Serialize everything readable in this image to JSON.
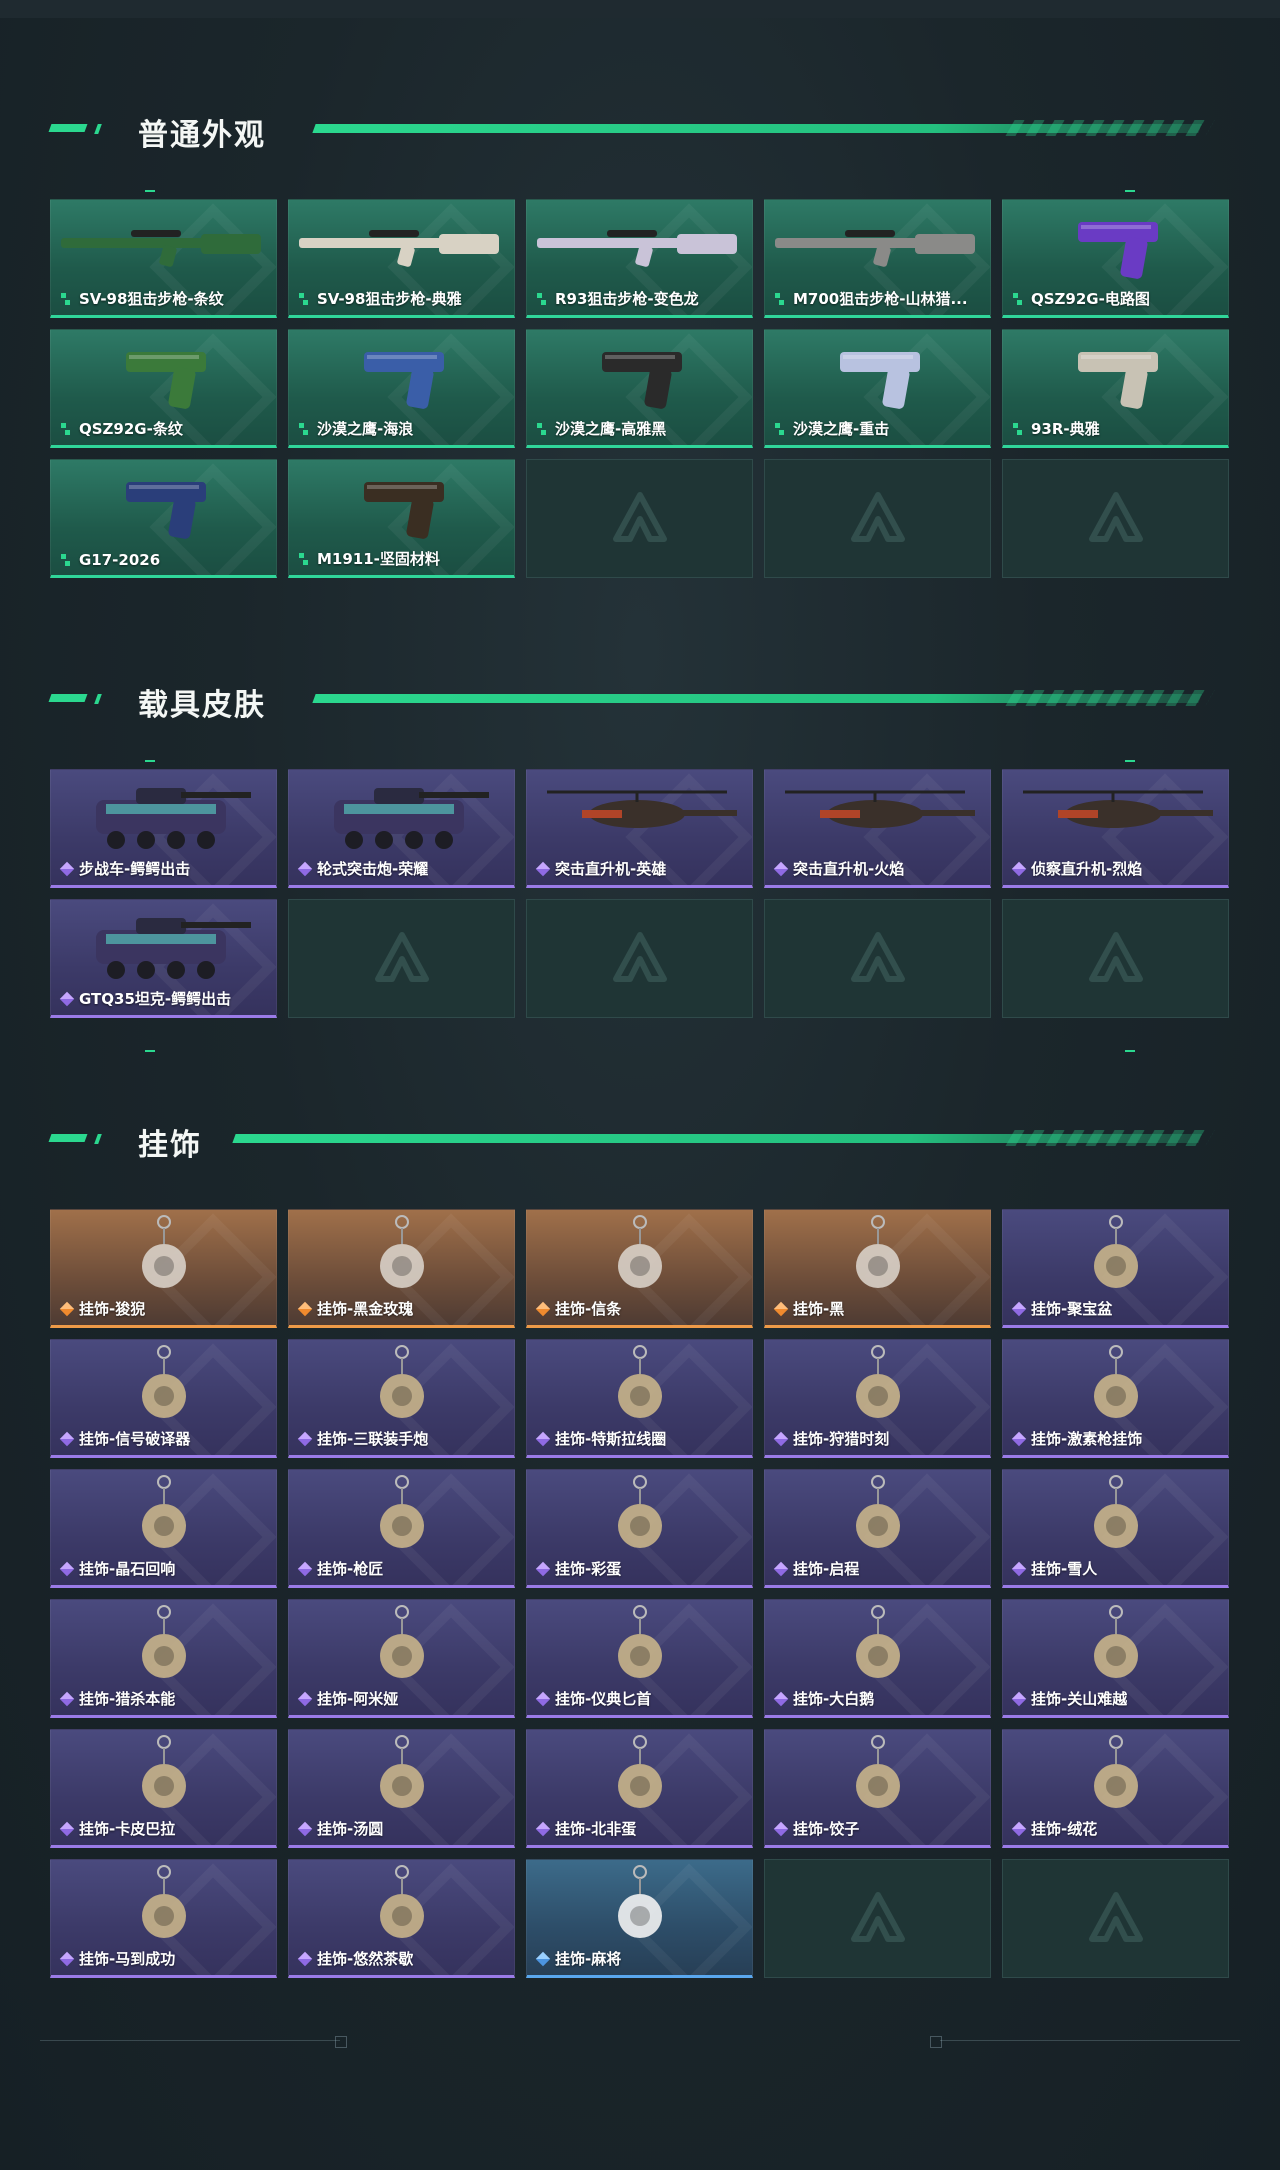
{
  "sections": [
    {
      "title": "普通外观",
      "items": [
        {
          "name": "SV-98狙击步枪-条纹",
          "rarity": "green",
          "icon": "sniper-rifle-icon"
        },
        {
          "name": "SV-98狙击步枪-典雅",
          "rarity": "green",
          "icon": "sniper-rifle-icon"
        },
        {
          "name": "R93狙击步枪-变色龙",
          "rarity": "green",
          "icon": "sniper-rifle-icon"
        },
        {
          "name": "M700狙击步枪-山林猎...",
          "rarity": "green",
          "icon": "sniper-rifle-icon"
        },
        {
          "name": "QSZ92G-电路图",
          "rarity": "green",
          "icon": "pistol-icon"
        },
        {
          "name": "QSZ92G-条纹",
          "rarity": "green",
          "icon": "pistol-icon"
        },
        {
          "name": "沙漠之鹰-海浪",
          "rarity": "green",
          "icon": "pistol-icon"
        },
        {
          "name": "沙漠之鹰-高雅黑",
          "rarity": "green",
          "icon": "pistol-icon"
        },
        {
          "name": "沙漠之鹰-重击",
          "rarity": "green",
          "icon": "pistol-icon"
        },
        {
          "name": "93R-典雅",
          "rarity": "green",
          "icon": "pistol-icon"
        },
        {
          "name": "G17-2026",
          "rarity": "green",
          "icon": "pistol-icon"
        },
        {
          "name": "M1911-坚固材料",
          "rarity": "green",
          "icon": "pistol-icon"
        }
      ],
      "empty_slots": 3
    },
    {
      "title": "载具皮肤",
      "items": [
        {
          "name": "步战车-鳄鳄出击",
          "rarity": "purple",
          "icon": "armored-vehicle-icon"
        },
        {
          "name": "轮式突击炮-荣耀",
          "rarity": "purple",
          "icon": "armored-vehicle-icon"
        },
        {
          "name": "突击直升机-英雄",
          "rarity": "purple",
          "icon": "helicopter-icon"
        },
        {
          "name": "突击直升机-火焰",
          "rarity": "purple",
          "icon": "helicopter-icon"
        },
        {
          "name": "侦察直升机-烈焰",
          "rarity": "purple",
          "icon": "helicopter-icon"
        },
        {
          "name": "GTQ35坦克-鳄鳄出击",
          "rarity": "purple",
          "icon": "tank-icon"
        }
      ],
      "empty_slots": 4
    },
    {
      "title": "挂饰",
      "items": [
        {
          "name": "挂饰-狻猊",
          "rarity": "orange",
          "icon": "charm-icon"
        },
        {
          "name": "挂饰-黑金玫瑰",
          "rarity": "orange",
          "icon": "charm-icon"
        },
        {
          "name": "挂饰-信条",
          "rarity": "orange",
          "icon": "charm-icon"
        },
        {
          "name": "挂饰-黑",
          "rarity": "orange",
          "icon": "charm-icon"
        },
        {
          "name": "挂饰-聚宝盆",
          "rarity": "purple",
          "icon": "charm-icon"
        },
        {
          "name": "挂饰-信号破译器",
          "rarity": "purple",
          "icon": "charm-icon"
        },
        {
          "name": "挂饰-三联装手炮",
          "rarity": "purple",
          "icon": "charm-icon"
        },
        {
          "name": "挂饰-特斯拉线圈",
          "rarity": "purple",
          "icon": "charm-icon"
        },
        {
          "name": "挂饰-狩猎时刻",
          "rarity": "purple",
          "icon": "charm-icon"
        },
        {
          "name": "挂饰-激素枪挂饰",
          "rarity": "purple",
          "icon": "charm-icon"
        },
        {
          "name": "挂饰-晶石回响",
          "rarity": "purple",
          "icon": "charm-icon"
        },
        {
          "name": "挂饰-枪匠",
          "rarity": "purple",
          "icon": "charm-icon"
        },
        {
          "name": "挂饰-彩蛋",
          "rarity": "purple",
          "icon": "charm-icon"
        },
        {
          "name": "挂饰-启程",
          "rarity": "purple",
          "icon": "charm-icon"
        },
        {
          "name": "挂饰-雪人",
          "rarity": "purple",
          "icon": "charm-icon"
        },
        {
          "name": "挂饰-猎杀本能",
          "rarity": "purple",
          "icon": "charm-icon"
        },
        {
          "name": "挂饰-阿米娅",
          "rarity": "purple",
          "icon": "charm-icon"
        },
        {
          "name": "挂饰-仪典匕首",
          "rarity": "purple",
          "icon": "charm-icon"
        },
        {
          "name": "挂饰-大白鹅",
          "rarity": "purple",
          "icon": "charm-icon"
        },
        {
          "name": "挂饰-关山难越",
          "rarity": "purple",
          "icon": "charm-icon"
        },
        {
          "name": "挂饰-卡皮巴拉",
          "rarity": "purple",
          "icon": "charm-icon"
        },
        {
          "name": "挂饰-汤圆",
          "rarity": "purple",
          "icon": "charm-icon"
        },
        {
          "name": "挂饰-北非蛋",
          "rarity": "purple",
          "icon": "charm-icon"
        },
        {
          "name": "挂饰-饺子",
          "rarity": "purple",
          "icon": "charm-icon"
        },
        {
          "name": "挂饰-绒花",
          "rarity": "purple",
          "icon": "charm-icon"
        },
        {
          "name": "挂饰-马到成功",
          "rarity": "purple",
          "icon": "charm-icon"
        },
        {
          "name": "挂饰-悠然茶歇",
          "rarity": "purple",
          "icon": "charm-icon"
        },
        {
          "name": "挂饰-麻将",
          "rarity": "blue",
          "icon": "charm-icon"
        }
      ],
      "empty_slots": 2
    }
  ],
  "colors": {
    "accent": "#2bd88f",
    "green_rarity": "#30d69a",
    "purple_rarity": "#9b7be8",
    "orange_rarity": "#ee9a48",
    "blue_rarity": "#5aa7ee"
  }
}
